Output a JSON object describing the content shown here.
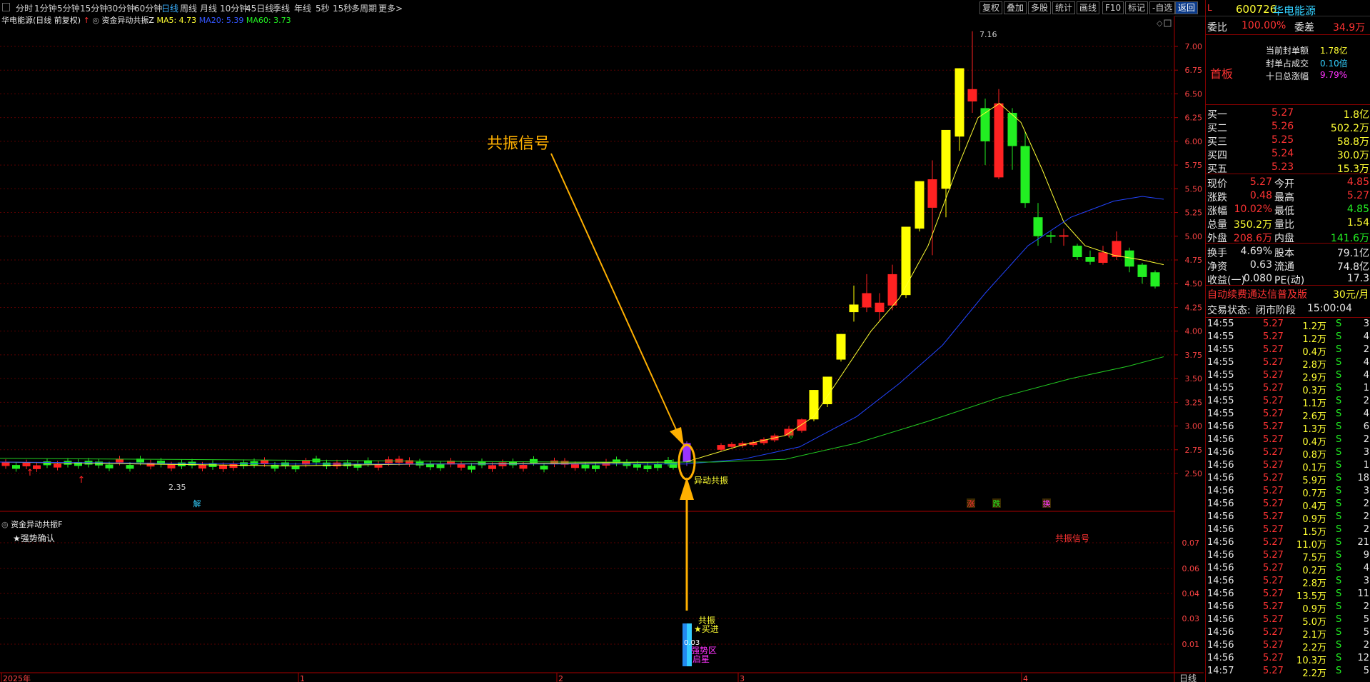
{
  "toolbar": {
    "period_tabs": [
      "分时",
      "1分钟",
      "5分钟",
      "15分钟",
      "30分钟",
      "60分钟",
      "日线",
      "周线",
      "月线",
      "10分钟",
      "45日线",
      "季线",
      "年线",
      "5秒",
      "15秒",
      "多周期",
      "更多>"
    ],
    "active_period": "日线",
    "right_buttons": [
      "复权",
      "叠加",
      "多股",
      "统计",
      "画线",
      "F10",
      "标记",
      "-自选",
      "返回"
    ]
  },
  "main_chart": {
    "header_stock": "华电能源(日线 前复权)",
    "indicator_name": "资金异动共振Z",
    "ma5_label": "MA5: 4.73",
    "ma20_label": "MA20: 5.39",
    "ma60_label": "MA60: 3.73",
    "colors": {
      "ma5": "#ffff33",
      "ma20": "#2244ff",
      "ma60": "#22cc22",
      "up": "#ff2222",
      "down": "#22ee22"
    },
    "price_ticks": [
      "7.00",
      "6.75",
      "6.50",
      "6.25",
      "6.00",
      "5.75",
      "5.50",
      "5.25",
      "5.00",
      "4.75",
      "4.50",
      "4.25",
      "4.00",
      "3.75",
      "3.50",
      "3.25",
      "3.00",
      "2.75",
      "2.50"
    ],
    "high_label": "7.16",
    "low_label": "2.35",
    "annotation_text": "共振信号",
    "signal_label": "异动共振",
    "markers": [
      "涨",
      "跌",
      "换"
    ],
    "marker_bottom_left": "解"
  },
  "sub_chart": {
    "indicator_name": "资金异动共振F",
    "legend": "★强势确认",
    "signal_text": "共振信号",
    "ticks": [
      "0.07",
      "0.06",
      "0.04",
      "0.03",
      "0.01"
    ],
    "bar_labels": [
      "共振",
      "★买进",
      "强势区",
      "启星"
    ],
    "bar_value": "0.03"
  },
  "x_axis": {
    "labels": [
      "2025年",
      "1",
      "2",
      "3",
      "4"
    ],
    "period_label": "日线"
  },
  "stock_info": {
    "prefix": "L",
    "code": "600726",
    "name": "华电能源",
    "weibi_label": "委比",
    "weibi_value": "100.00%",
    "weicha_label": "委差",
    "weicha_value": "34.9万",
    "board_label": "首板",
    "seal_amount_label": "当前封单额",
    "seal_amount_value": "1.78亿",
    "seal_ratio_label": "封单占成交",
    "seal_ratio_value": "0.10倍",
    "ten_day_label": "十日总涨幅",
    "ten_day_value": "9.79%",
    "buy_orders": [
      {
        "label": "买一",
        "price": "5.27",
        "vol": "1.8亿"
      },
      {
        "label": "买二",
        "price": "5.26",
        "vol": "502.2万"
      },
      {
        "label": "买三",
        "price": "5.25",
        "vol": "58.8万"
      },
      {
        "label": "买四",
        "price": "5.24",
        "vol": "30.0万"
      },
      {
        "label": "买五",
        "price": "5.23",
        "vol": "15.3万"
      }
    ],
    "quote_rows": [
      {
        "l1": "现价",
        "v1": "5.27",
        "l2": "今开",
        "v2": "4.85"
      },
      {
        "l1": "涨跌",
        "v1": "0.48",
        "l2": "最高",
        "v2": "5.27"
      },
      {
        "l1": "涨幅",
        "v1": "10.02%",
        "l2": "最低",
        "v2": "4.85"
      },
      {
        "l1": "总量",
        "v1": "350.2万",
        "l2": "量比",
        "v2": "1.54"
      },
      {
        "l1": "外盘",
        "v1": "208.6万",
        "l2": "内盘",
        "v2": "141.6万"
      }
    ],
    "fund_rows": [
      {
        "l1": "换手",
        "v1": "4.69%",
        "l2": "股本",
        "v2": "79.1亿"
      },
      {
        "l1": "净资",
        "v1": "0.63",
        "l2": "流通",
        "v2": "74.8亿"
      },
      {
        "l1": "收益(一)",
        "v1": "0.080",
        "l2": "PE(动)",
        "v2": "17.3"
      }
    ],
    "promo_text": "自动续费通达信普及版",
    "promo_price": "30元/月",
    "trade_status_label": "交易状态:",
    "trade_status_value": "闭市阶段",
    "trade_time": "15:00:04"
  },
  "ticks_list": [
    {
      "t": "14:55",
      "p": "5.27",
      "v": "1.2万",
      "s": "S",
      "n": "3"
    },
    {
      "t": "14:55",
      "p": "5.27",
      "v": "1.2万",
      "s": "S",
      "n": "4"
    },
    {
      "t": "14:55",
      "p": "5.27",
      "v": "0.4万",
      "s": "S",
      "n": "2"
    },
    {
      "t": "14:55",
      "p": "5.27",
      "v": "2.8万",
      "s": "S",
      "n": "4"
    },
    {
      "t": "14:55",
      "p": "5.27",
      "v": "2.9万",
      "s": "S",
      "n": "4"
    },
    {
      "t": "14:55",
      "p": "5.27",
      "v": "0.3万",
      "s": "S",
      "n": "1"
    },
    {
      "t": "14:55",
      "p": "5.27",
      "v": "1.1万",
      "s": "S",
      "n": "2"
    },
    {
      "t": "14:55",
      "p": "5.27",
      "v": "2.6万",
      "s": "S",
      "n": "4"
    },
    {
      "t": "14:56",
      "p": "5.27",
      "v": "1.3万",
      "s": "S",
      "n": "6"
    },
    {
      "t": "14:56",
      "p": "5.27",
      "v": "0.4万",
      "s": "S",
      "n": "2"
    },
    {
      "t": "14:56",
      "p": "5.27",
      "v": "0.8万",
      "s": "S",
      "n": "3"
    },
    {
      "t": "14:56",
      "p": "5.27",
      "v": "0.1万",
      "s": "S",
      "n": "1"
    },
    {
      "t": "14:56",
      "p": "5.27",
      "v": "5.9万",
      "s": "S",
      "n": "18"
    },
    {
      "t": "14:56",
      "p": "5.27",
      "v": "0.7万",
      "s": "S",
      "n": "3"
    },
    {
      "t": "14:56",
      "p": "5.27",
      "v": "0.4万",
      "s": "S",
      "n": "2"
    },
    {
      "t": "14:56",
      "p": "5.27",
      "v": "0.9万",
      "s": "S",
      "n": "2"
    },
    {
      "t": "14:56",
      "p": "5.27",
      "v": "1.5万",
      "s": "S",
      "n": "2"
    },
    {
      "t": "14:56",
      "p": "5.27",
      "v": "11.0万",
      "s": "S",
      "n": "21"
    },
    {
      "t": "14:56",
      "p": "5.27",
      "v": "7.5万",
      "s": "S",
      "n": "9"
    },
    {
      "t": "14:56",
      "p": "5.27",
      "v": "0.2万",
      "s": "S",
      "n": "4"
    },
    {
      "t": "14:56",
      "p": "5.27",
      "v": "2.8万",
      "s": "S",
      "n": "3"
    },
    {
      "t": "14:56",
      "p": "5.27",
      "v": "13.5万",
      "s": "S",
      "n": "11"
    },
    {
      "t": "14:56",
      "p": "5.27",
      "v": "0.9万",
      "s": "S",
      "n": "2"
    },
    {
      "t": "14:56",
      "p": "5.27",
      "v": "5.0万",
      "s": "S",
      "n": "5"
    },
    {
      "t": "14:56",
      "p": "5.27",
      "v": "2.1万",
      "s": "S",
      "n": "5"
    },
    {
      "t": "14:56",
      "p": "5.27",
      "v": "2.2万",
      "s": "S",
      "n": "2"
    },
    {
      "t": "14:56",
      "p": "5.27",
      "v": "10.3万",
      "s": "S",
      "n": "12"
    },
    {
      "t": "14:57",
      "p": "5.27",
      "v": "2.2万",
      "s": "S",
      "n": "5"
    }
  ]
}
